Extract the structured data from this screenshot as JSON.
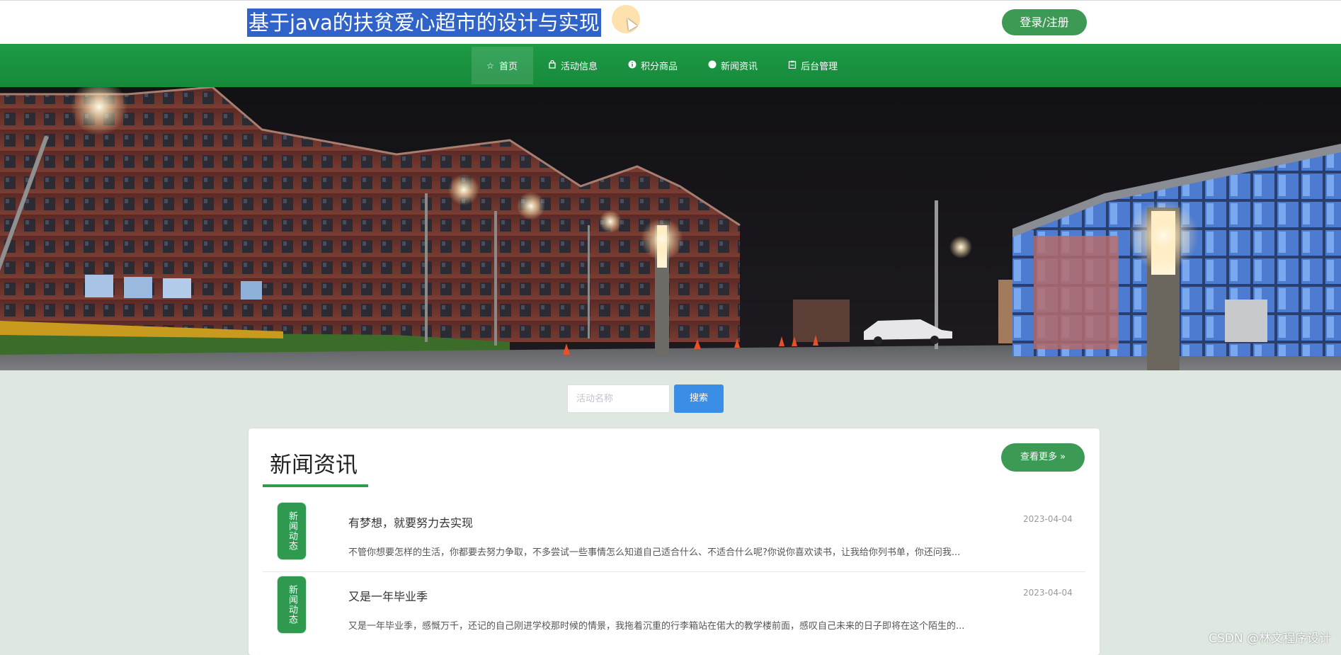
{
  "header": {
    "title": "基于java的扶贫爱心超市的设计与实现",
    "login_label": "登录/注册"
  },
  "nav": {
    "items": [
      {
        "label": "首页",
        "icon": "star-icon",
        "active": true
      },
      {
        "label": "活动信息",
        "icon": "bag-icon"
      },
      {
        "label": "积分商品",
        "icon": "info-circle-icon"
      },
      {
        "label": "新闻资讯",
        "icon": "dot-icon"
      },
      {
        "label": "后台管理",
        "icon": "clipboard-icon"
      }
    ]
  },
  "search": {
    "placeholder": "活动名称",
    "button_label": "搜索"
  },
  "news": {
    "section_title": "新闻资讯",
    "more_label": "查看更多 »",
    "items": [
      {
        "badge": "新闻动态",
        "title": "有梦想，就要努力去实现",
        "date": "2023-04-04",
        "summary": "不管你想要怎样的生活，你都要去努力争取，不多尝试一些事情怎么知道自己适合什么、不适合什么呢?你说你喜欢读书，让我给你列书单，你还问我..."
      },
      {
        "badge": "新闻动态",
        "title": "又是一年毕业季",
        "date": "2023-04-04",
        "summary": "又是一年毕业季，感慨万千，还记的自己刚进学校那时候的情景，我拖着沉重的行李箱站在偌大的教学楼前面，感叹自己未来的日子即将在这个陌生的..."
      }
    ]
  },
  "watermark": "CSDN @林文程序设计",
  "colors": {
    "brand_green": "#1e9a45",
    "button_green": "#3d9a55",
    "search_blue": "#3a8ee6",
    "page_bg": "#dfe7e1",
    "selection_blue": "#2f63c9"
  }
}
